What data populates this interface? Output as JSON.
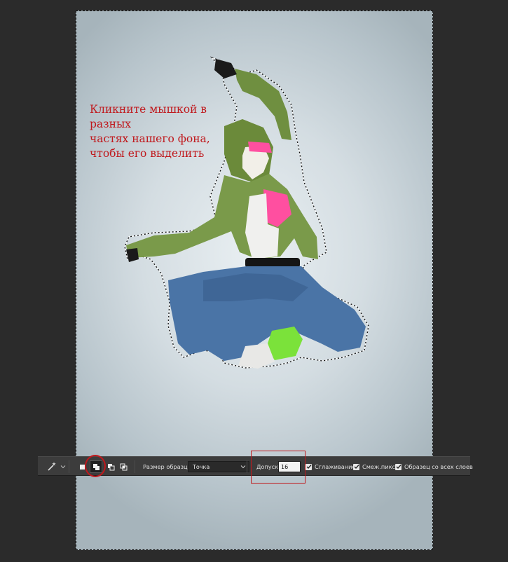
{
  "instruction": {
    "line1": "Кликните мышкой в разных",
    "line2": "частях нашего фона,",
    "line3": "чтобы его выделить"
  },
  "options_bar": {
    "tool_icon": "magic-wand-icon",
    "selection_modes": [
      "new-selection-icon",
      "add-to-selection-icon",
      "subtract-from-selection-icon",
      "intersect-selection-icon"
    ],
    "active_mode": "add-to-selection-icon",
    "sample_size_label": "Размер образца:",
    "sample_size_value": "Точка",
    "tolerance_label": "Допуск:",
    "tolerance_value": "16",
    "antialias_label": "Сглаживание",
    "antialias_checked": true,
    "contiguous_label": "Смеж.пикс",
    "contiguous_checked": true,
    "sample_all_layers_label": "Образец со всех слоев",
    "sample_all_layers_checked": true
  },
  "colors": {
    "workspace": "#2b2b2b",
    "options_bar": "#3c3c3c",
    "annotation_red": "#c0181c",
    "jacket_green": "#7a9a4a",
    "top_pink": "#ff4fa0",
    "jeans_blue": "#4a74a6",
    "leg_warmer": "#7be23a"
  }
}
